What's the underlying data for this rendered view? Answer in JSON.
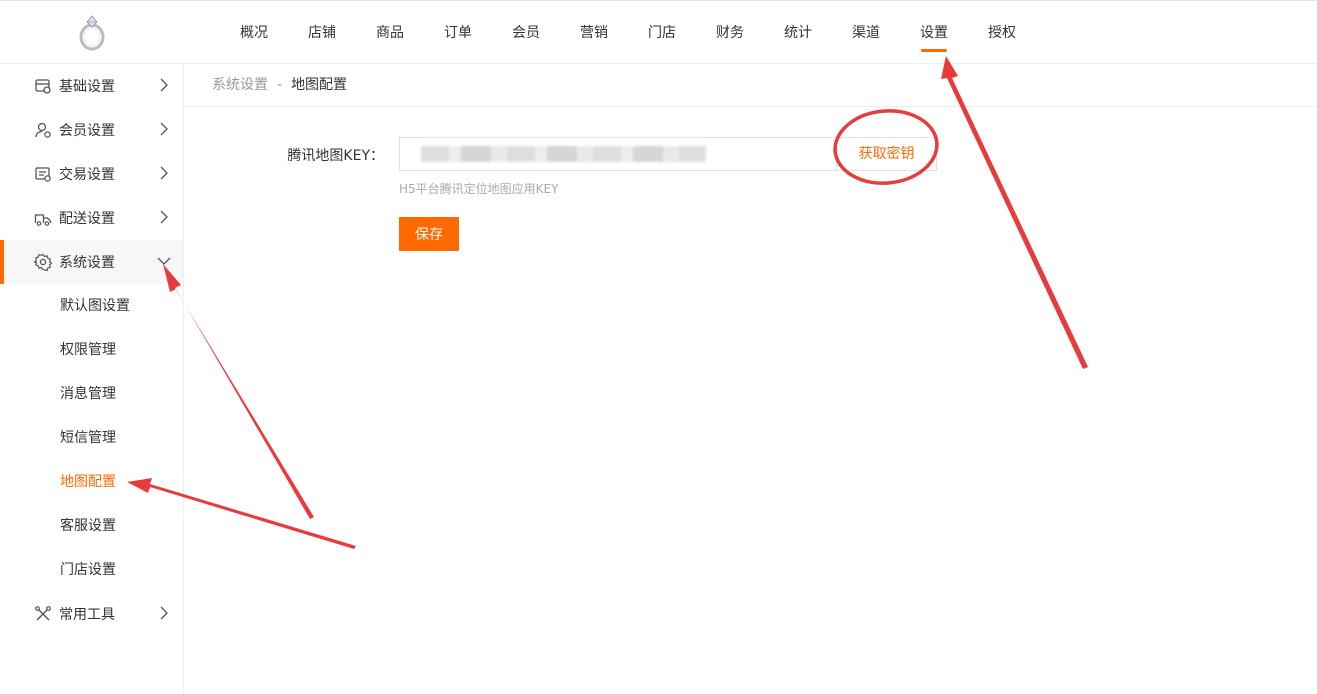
{
  "header": {
    "nav": [
      "概况",
      "店铺",
      "商品",
      "订单",
      "会员",
      "营销",
      "门店",
      "财务",
      "统计",
      "渠道",
      "设置",
      "授权"
    ],
    "active_nav": "设置"
  },
  "sidebar": {
    "items": [
      {
        "label": "基础设置",
        "icon": "settings-card-icon",
        "expanded": false
      },
      {
        "label": "会员设置",
        "icon": "member-settings-icon",
        "expanded": false
      },
      {
        "label": "交易设置",
        "icon": "trade-settings-icon",
        "expanded": false
      },
      {
        "label": "配送设置",
        "icon": "delivery-truck-icon",
        "expanded": false
      },
      {
        "label": "系统设置",
        "icon": "gear-icon",
        "expanded": true
      },
      {
        "label": "常用工具",
        "icon": "tools-icon",
        "expanded": false
      }
    ],
    "sub_items": [
      "默认图设置",
      "权限管理",
      "消息管理",
      "短信管理",
      "地图配置",
      "客服设置",
      "门店设置"
    ],
    "active_sub": "地图配置"
  },
  "breadcrumb": {
    "parent": "系统设置",
    "separator": "-",
    "current": "地图配置"
  },
  "form": {
    "label": "腾讯地图KEY：",
    "input_value": "",
    "get_key_label": "获取密钥",
    "hint": "H5平台腾讯定位地图应用KEY",
    "save_label": "保存"
  },
  "colors": {
    "accent": "#ff6a00",
    "annotation": "#e83b3b"
  }
}
